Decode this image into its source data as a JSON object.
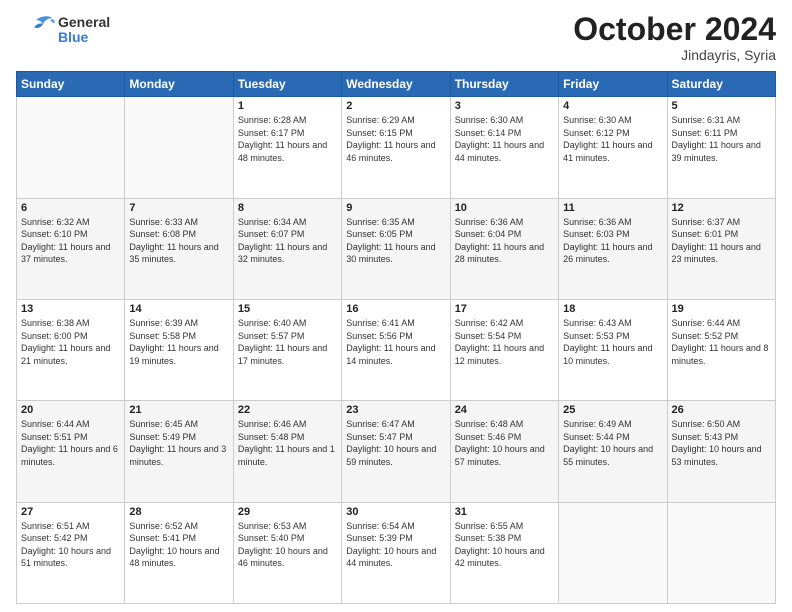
{
  "header": {
    "logo": {
      "general": "General",
      "blue": "Blue"
    },
    "month_title": "October 2024",
    "subtitle": "Jindayris, Syria"
  },
  "weekdays": [
    "Sunday",
    "Monday",
    "Tuesday",
    "Wednesday",
    "Thursday",
    "Friday",
    "Saturday"
  ],
  "weeks": [
    [
      {
        "day": "",
        "sunrise": "",
        "sunset": "",
        "daylight": ""
      },
      {
        "day": "",
        "sunrise": "",
        "sunset": "",
        "daylight": ""
      },
      {
        "day": "1",
        "sunrise": "Sunrise: 6:28 AM",
        "sunset": "Sunset: 6:17 PM",
        "daylight": "Daylight: 11 hours and 48 minutes."
      },
      {
        "day": "2",
        "sunrise": "Sunrise: 6:29 AM",
        "sunset": "Sunset: 6:15 PM",
        "daylight": "Daylight: 11 hours and 46 minutes."
      },
      {
        "day": "3",
        "sunrise": "Sunrise: 6:30 AM",
        "sunset": "Sunset: 6:14 PM",
        "daylight": "Daylight: 11 hours and 44 minutes."
      },
      {
        "day": "4",
        "sunrise": "Sunrise: 6:30 AM",
        "sunset": "Sunset: 6:12 PM",
        "daylight": "Daylight: 11 hours and 41 minutes."
      },
      {
        "day": "5",
        "sunrise": "Sunrise: 6:31 AM",
        "sunset": "Sunset: 6:11 PM",
        "daylight": "Daylight: 11 hours and 39 minutes."
      }
    ],
    [
      {
        "day": "6",
        "sunrise": "Sunrise: 6:32 AM",
        "sunset": "Sunset: 6:10 PM",
        "daylight": "Daylight: 11 hours and 37 minutes."
      },
      {
        "day": "7",
        "sunrise": "Sunrise: 6:33 AM",
        "sunset": "Sunset: 6:08 PM",
        "daylight": "Daylight: 11 hours and 35 minutes."
      },
      {
        "day": "8",
        "sunrise": "Sunrise: 6:34 AM",
        "sunset": "Sunset: 6:07 PM",
        "daylight": "Daylight: 11 hours and 32 minutes."
      },
      {
        "day": "9",
        "sunrise": "Sunrise: 6:35 AM",
        "sunset": "Sunset: 6:05 PM",
        "daylight": "Daylight: 11 hours and 30 minutes."
      },
      {
        "day": "10",
        "sunrise": "Sunrise: 6:36 AM",
        "sunset": "Sunset: 6:04 PM",
        "daylight": "Daylight: 11 hours and 28 minutes."
      },
      {
        "day": "11",
        "sunrise": "Sunrise: 6:36 AM",
        "sunset": "Sunset: 6:03 PM",
        "daylight": "Daylight: 11 hours and 26 minutes."
      },
      {
        "day": "12",
        "sunrise": "Sunrise: 6:37 AM",
        "sunset": "Sunset: 6:01 PM",
        "daylight": "Daylight: 11 hours and 23 minutes."
      }
    ],
    [
      {
        "day": "13",
        "sunrise": "Sunrise: 6:38 AM",
        "sunset": "Sunset: 6:00 PM",
        "daylight": "Daylight: 11 hours and 21 minutes."
      },
      {
        "day": "14",
        "sunrise": "Sunrise: 6:39 AM",
        "sunset": "Sunset: 5:58 PM",
        "daylight": "Daylight: 11 hours and 19 minutes."
      },
      {
        "day": "15",
        "sunrise": "Sunrise: 6:40 AM",
        "sunset": "Sunset: 5:57 PM",
        "daylight": "Daylight: 11 hours and 17 minutes."
      },
      {
        "day": "16",
        "sunrise": "Sunrise: 6:41 AM",
        "sunset": "Sunset: 5:56 PM",
        "daylight": "Daylight: 11 hours and 14 minutes."
      },
      {
        "day": "17",
        "sunrise": "Sunrise: 6:42 AM",
        "sunset": "Sunset: 5:54 PM",
        "daylight": "Daylight: 11 hours and 12 minutes."
      },
      {
        "day": "18",
        "sunrise": "Sunrise: 6:43 AM",
        "sunset": "Sunset: 5:53 PM",
        "daylight": "Daylight: 11 hours and 10 minutes."
      },
      {
        "day": "19",
        "sunrise": "Sunrise: 6:44 AM",
        "sunset": "Sunset: 5:52 PM",
        "daylight": "Daylight: 11 hours and 8 minutes."
      }
    ],
    [
      {
        "day": "20",
        "sunrise": "Sunrise: 6:44 AM",
        "sunset": "Sunset: 5:51 PM",
        "daylight": "Daylight: 11 hours and 6 minutes."
      },
      {
        "day": "21",
        "sunrise": "Sunrise: 6:45 AM",
        "sunset": "Sunset: 5:49 PM",
        "daylight": "Daylight: 11 hours and 3 minutes."
      },
      {
        "day": "22",
        "sunrise": "Sunrise: 6:46 AM",
        "sunset": "Sunset: 5:48 PM",
        "daylight": "Daylight: 11 hours and 1 minute."
      },
      {
        "day": "23",
        "sunrise": "Sunrise: 6:47 AM",
        "sunset": "Sunset: 5:47 PM",
        "daylight": "Daylight: 10 hours and 59 minutes."
      },
      {
        "day": "24",
        "sunrise": "Sunrise: 6:48 AM",
        "sunset": "Sunset: 5:46 PM",
        "daylight": "Daylight: 10 hours and 57 minutes."
      },
      {
        "day": "25",
        "sunrise": "Sunrise: 6:49 AM",
        "sunset": "Sunset: 5:44 PM",
        "daylight": "Daylight: 10 hours and 55 minutes."
      },
      {
        "day": "26",
        "sunrise": "Sunrise: 6:50 AM",
        "sunset": "Sunset: 5:43 PM",
        "daylight": "Daylight: 10 hours and 53 minutes."
      }
    ],
    [
      {
        "day": "27",
        "sunrise": "Sunrise: 6:51 AM",
        "sunset": "Sunset: 5:42 PM",
        "daylight": "Daylight: 10 hours and 51 minutes."
      },
      {
        "day": "28",
        "sunrise": "Sunrise: 6:52 AM",
        "sunset": "Sunset: 5:41 PM",
        "daylight": "Daylight: 10 hours and 48 minutes."
      },
      {
        "day": "29",
        "sunrise": "Sunrise: 6:53 AM",
        "sunset": "Sunset: 5:40 PM",
        "daylight": "Daylight: 10 hours and 46 minutes."
      },
      {
        "day": "30",
        "sunrise": "Sunrise: 6:54 AM",
        "sunset": "Sunset: 5:39 PM",
        "daylight": "Daylight: 10 hours and 44 minutes."
      },
      {
        "day": "31",
        "sunrise": "Sunrise: 6:55 AM",
        "sunset": "Sunset: 5:38 PM",
        "daylight": "Daylight: 10 hours and 42 minutes."
      },
      {
        "day": "",
        "sunrise": "",
        "sunset": "",
        "daylight": ""
      },
      {
        "day": "",
        "sunrise": "",
        "sunset": "",
        "daylight": ""
      }
    ]
  ]
}
